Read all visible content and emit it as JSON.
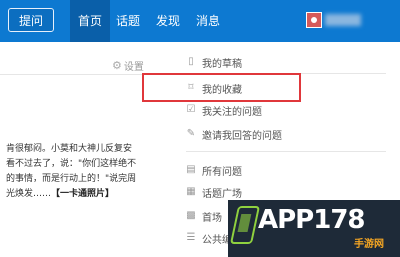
{
  "topnav": {
    "ask_label": "提问",
    "tabs": [
      {
        "label": "首页",
        "active": true
      },
      {
        "label": "话题",
        "active": false
      },
      {
        "label": "发现",
        "active": false
      },
      {
        "label": "消息",
        "active": false
      }
    ],
    "accent_color": "#0d79d1"
  },
  "settings_label": "设置",
  "feed": {
    "lines": [
      "肯很郁闷。小莫和大神儿反复安",
      "看不过去了，说：\"你们这样绝不",
      "的事情，而是行动上的！\"说完周"
    ],
    "last_line_prefix": "光焕发……",
    "last_line_link": "【一卡通照片】"
  },
  "menu": {
    "items": [
      {
        "label": "我的草稿",
        "icon": "document-icon"
      },
      {
        "label": "我的收藏",
        "icon": "bookmark-icon"
      },
      {
        "label": "我关注的问题",
        "icon": "checkbox-icon"
      },
      {
        "label": "邀请我回答的问题",
        "icon": "edit-icon"
      },
      {
        "label": "所有问题",
        "icon": "list-icon"
      },
      {
        "label": "话题广场",
        "icon": "grid-icon"
      },
      {
        "label": "首场",
        "icon": "stack-icon"
      },
      {
        "label": "公共编",
        "icon": "lines-icon"
      }
    ],
    "highlight_color": "#e0373b"
  },
  "watermark": {
    "text_main": "APP178",
    "text_sub": "手游网"
  }
}
